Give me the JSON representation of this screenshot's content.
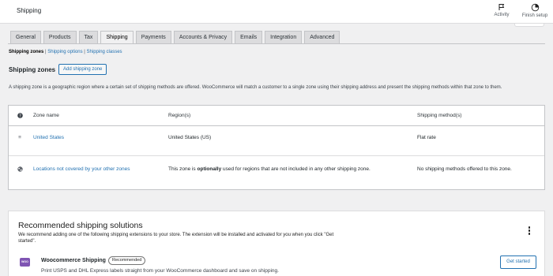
{
  "header": {
    "title": "Shipping",
    "activity_label": "Activity",
    "finish_setup_label": "Finish setup"
  },
  "tabs": [
    {
      "label": "General",
      "active": false
    },
    {
      "label": "Products",
      "active": false
    },
    {
      "label": "Tax",
      "active": false
    },
    {
      "label": "Shipping",
      "active": true
    },
    {
      "label": "Payments",
      "active": false
    },
    {
      "label": "Accounts & Privacy",
      "active": false
    },
    {
      "label": "Emails",
      "active": false
    },
    {
      "label": "Integration",
      "active": false
    },
    {
      "label": "Advanced",
      "active": false
    }
  ],
  "subnav": {
    "zones": "Shipping zones",
    "options": "Shipping options",
    "classes": "Shipping classes",
    "separator": "|"
  },
  "zones_section": {
    "heading": "Shipping zones",
    "add_button": "Add shipping zone",
    "description": "A shipping zone is a geographic region where a certain set of shipping methods are offered. WooCommerce will match a customer to a single zone using their shipping address and present the shipping methods within that zone to them."
  },
  "zones_table": {
    "headers": {
      "help_icon": "help-icon",
      "name": "Zone name",
      "regions": "Region(s)",
      "methods": "Shipping method(s)"
    },
    "rows": [
      {
        "icon": "drag-handle-icon",
        "icon_glyph": "≡",
        "name": "United States",
        "regions": "United States (US)",
        "methods": "Flat rate"
      },
      {
        "icon": "globe-icon",
        "icon_glyph": "◕",
        "name": "Locations not covered by your other zones",
        "regions_prefix": "This zone is ",
        "regions_emphasis": "optionally",
        "regions_suffix": " used for regions that are not included in any other shipping zone.",
        "methods": "No shipping methods offered to this zone."
      }
    ]
  },
  "recommended": {
    "title": "Recommended shipping solutions",
    "description": "We recommend adding one of the following shipping extensions to your store. The extension will be installed and activated for you when you click \"Get started\".",
    "extension": {
      "logo_text": "WOO",
      "name": "Woocommerce Shipping",
      "badge": "Recommended",
      "description": "Print USPS and DHL Express labels straight from your WooCommerce dashboard and save on shipping.",
      "button": "Get started"
    }
  },
  "colors": {
    "accent": "#2271b1",
    "background": "#f0f0f1",
    "woo_purple": "#7f54b3"
  }
}
